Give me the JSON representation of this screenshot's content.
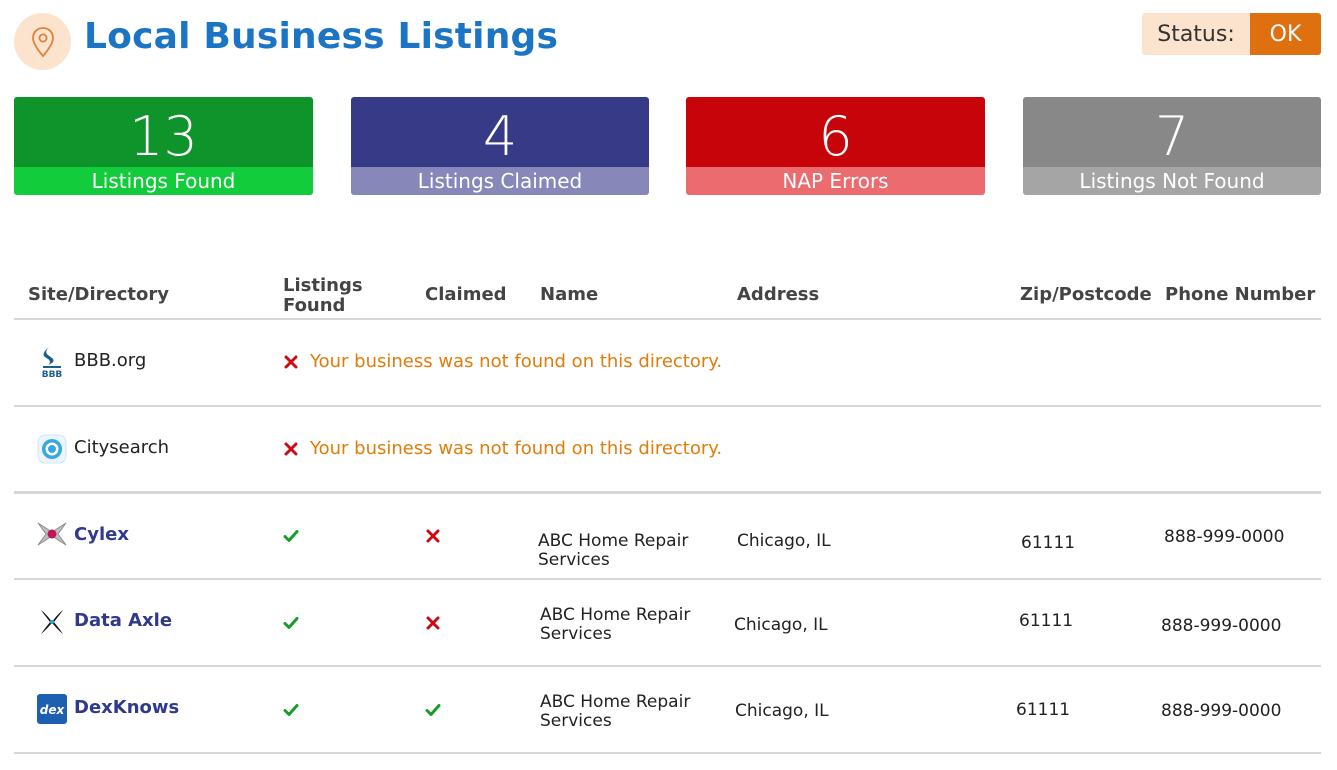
{
  "header": {
    "title": "Local Business Listings",
    "icon": "map-pin-icon",
    "status_label": "Status:",
    "status_value": "OK"
  },
  "colors": {
    "title": "#1b74c4",
    "status_value_bg": "#de7010",
    "status_label_bg": "#fbe3cd",
    "found": "#0f932b",
    "claimed": "#373a87",
    "nap_errors": "#c8040b",
    "not_found": "#888888",
    "check": "#1a9c2a",
    "cross": "#cc0b14",
    "warning_text": "#e07c0a"
  },
  "kpis": [
    {
      "value": "13",
      "label": "Listings Found"
    },
    {
      "value": "4",
      "label": "Listings Claimed"
    },
    {
      "value": "6",
      "label": "NAP Errors"
    },
    {
      "value": "7",
      "label": "Listings Not Found"
    }
  ],
  "table": {
    "headers": {
      "site": "Site/Directory",
      "found_l1": "Listings",
      "found_l2": "Found",
      "claimed": "Claimed",
      "name": "Name",
      "address": "Address",
      "zip": "Zip/Postcode",
      "phone": "Phone Number"
    },
    "rows": [
      {
        "site": "BBB.org",
        "logo": "bbb-logo-icon",
        "message": "Your business was not found on this directory."
      },
      {
        "site": "Citysearch",
        "logo": "citysearch-logo-icon",
        "message": "Your business was not found on this directory."
      },
      {
        "site": "Cylex",
        "logo": "cylex-logo-icon",
        "found": true,
        "claimed": false,
        "name_l1": "ABC Home Repair",
        "name_l2": "Services",
        "address": "Chicago, IL",
        "zip": "61111",
        "phone": "888-999-0000"
      },
      {
        "site": "Data Axle",
        "logo": "data-axle-logo-icon",
        "found": true,
        "claimed": false,
        "name_l1": "ABC Home Repair",
        "name_l2": "Services",
        "address": "Chicago, IL",
        "zip": "61111",
        "phone": "888-999-0000"
      },
      {
        "site": "DexKnows",
        "logo": "dexknows-logo-icon",
        "found": true,
        "claimed": true,
        "name_l1": "ABC Home Repair",
        "name_l2": "Services",
        "address": "Chicago, IL",
        "zip": "61111",
        "phone": "888-999-0000"
      }
    ]
  }
}
